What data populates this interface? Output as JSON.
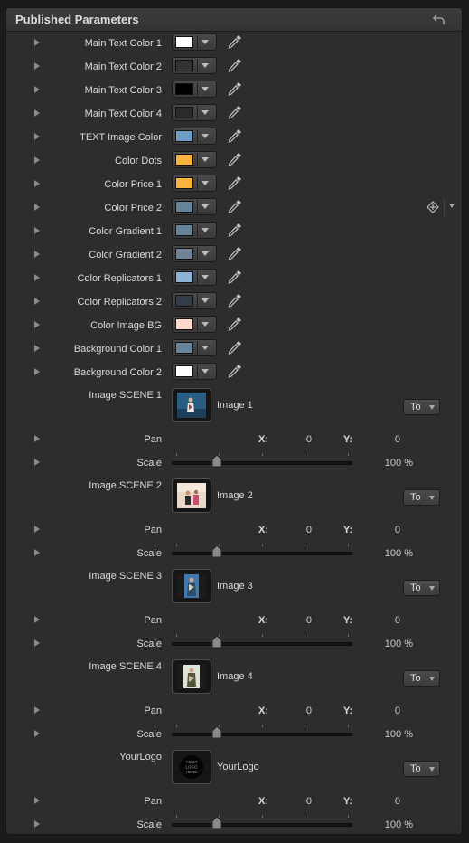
{
  "panel": {
    "title": "Published Parameters"
  },
  "colors": [
    {
      "label": "Main Text Color 1",
      "color": "#ffffff"
    },
    {
      "label": "Main Text Color 2",
      "color": "#333333"
    },
    {
      "label": "Main Text Color 3",
      "color": "#000000"
    },
    {
      "label": "Main Text Color 4",
      "color": "#2a2a2a"
    },
    {
      "label": "TEXT Image Color",
      "color": "#6f9dc8"
    },
    {
      "label": "Color Dots",
      "color": "#f9b43e"
    },
    {
      "label": "Color Price 1",
      "color": "#f9b43e"
    },
    {
      "label": "Color Price 2",
      "color": "#668499"
    },
    {
      "label": "Color Gradient 1",
      "color": "#668499"
    },
    {
      "label": "Color Gradient 2",
      "color": "#6f8296"
    },
    {
      "label": "Color Replicators 1",
      "color": "#8cb3d6"
    },
    {
      "label": "Color Replicators 2",
      "color": "#333c48"
    },
    {
      "label": "Color Image BG",
      "color": "#fcd9cc"
    },
    {
      "label": "Background Color 1",
      "color": "#698399"
    },
    {
      "label": "Background Color 2",
      "color": "#ffffff"
    }
  ],
  "images": [
    {
      "label": "Image SCENE 1",
      "name": "Image 1",
      "mode": "To",
      "pan_label": "Pan",
      "x_label": "X:",
      "x": "0",
      "y_label": "Y:",
      "y": "0",
      "scale_label": "Scale",
      "scale": "100 %",
      "scale_percent": 100
    },
    {
      "label": "Image SCENE 2",
      "name": "Image 2",
      "mode": "To",
      "pan_label": "Pan",
      "x_label": "X:",
      "x": "0",
      "y_label": "Y:",
      "y": "0",
      "scale_label": "Scale",
      "scale": "100 %",
      "scale_percent": 100
    },
    {
      "label": "Image SCENE 3",
      "name": "Image 3",
      "mode": "To",
      "pan_label": "Pan",
      "x_label": "X:",
      "x": "0",
      "y_label": "Y:",
      "y": "0",
      "scale_label": "Scale",
      "scale": "100 %",
      "scale_percent": 100
    },
    {
      "label": "Image SCENE 4",
      "name": "Image 4",
      "mode": "To",
      "pan_label": "Pan",
      "x_label": "X:",
      "x": "0",
      "y_label": "Y:",
      "y": "0",
      "scale_label": "Scale",
      "scale": "100 %",
      "scale_percent": 100
    },
    {
      "label": "YourLogo",
      "name": "YourLogo",
      "mode": "To",
      "pan_label": "Pan",
      "x_label": "X:",
      "x": "0",
      "y_label": "Y:",
      "y": "0",
      "scale_label": "Scale",
      "scale": "100 %",
      "scale_percent": 100,
      "logo_text": "YOUR LOGO HERE"
    }
  ],
  "icons": {
    "reset": "reset-arrow-icon",
    "eyedropper": "eyedropper-icon",
    "keyframe": "keyframe-diamond-icon"
  }
}
